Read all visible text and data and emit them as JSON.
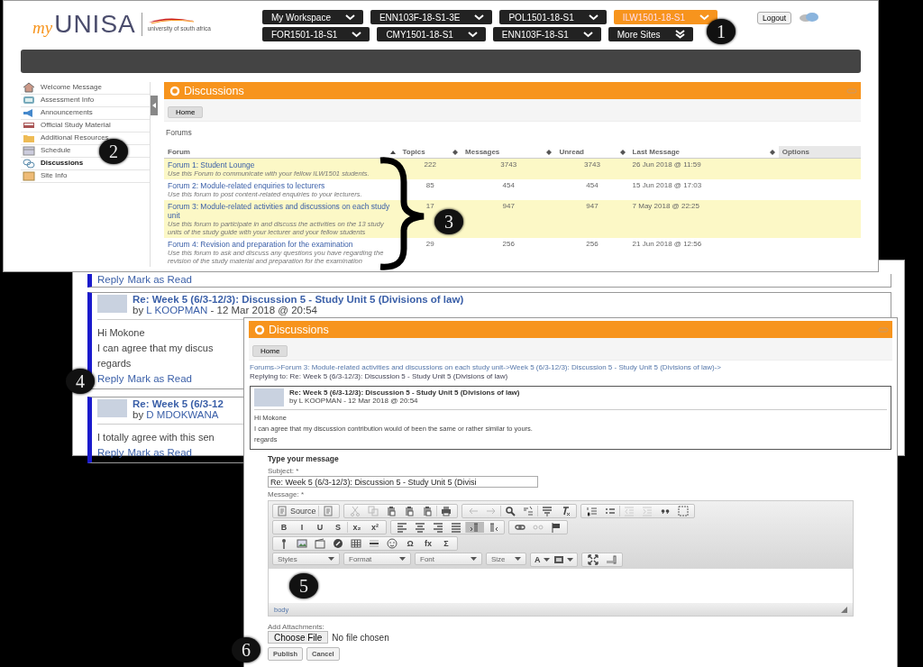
{
  "top_window": {
    "logo": {
      "prefix": "my",
      "name": "UNISA",
      "tagline": "university of south africa"
    },
    "site_tabs": [
      {
        "label": "My Workspace",
        "kind": "menu",
        "selected": false
      },
      {
        "label": "ENN103F-18-S1-3E",
        "kind": "menu",
        "selected": false
      },
      {
        "label": "POL1501-18-S1",
        "kind": "menu",
        "selected": false
      },
      {
        "label": "ILW1501-18-S1",
        "kind": "menu",
        "selected": true
      },
      {
        "label": "FOR1501-18-S1",
        "kind": "menu",
        "selected": false
      },
      {
        "label": "CMY1501-18-S1",
        "kind": "menu",
        "selected": false
      },
      {
        "label": "ENN103F-18-S1",
        "kind": "menu",
        "selected": false
      },
      {
        "label": "More Sites",
        "kind": "more",
        "selected": false
      }
    ],
    "logout": "Logout",
    "sidebar": {
      "items": [
        {
          "label": "Welcome Message",
          "selected": false
        },
        {
          "label": "Assessment Info",
          "selected": false
        },
        {
          "label": "Announcements",
          "selected": false
        },
        {
          "label": "Official Study Material",
          "selected": false
        },
        {
          "label": "Additional Resources",
          "selected": false
        },
        {
          "label": "Schedule",
          "selected": false
        },
        {
          "label": "Discussions",
          "selected": true
        },
        {
          "label": "Site Info",
          "selected": false
        }
      ]
    },
    "tool_title": "Discussions",
    "home": "Home",
    "section": "Forums",
    "table": {
      "columns": [
        {
          "label": "Forum",
          "sorted": true
        },
        {
          "label": "Topics",
          "sorted": false
        },
        {
          "label": "Messages",
          "sorted": false
        },
        {
          "label": "Unread",
          "sorted": false
        },
        {
          "label": "Last Message",
          "sorted": false
        },
        {
          "label": "Options"
        }
      ],
      "rows": [
        {
          "title": "Forum 1: Student Lounge",
          "description": "Use this Forum to communicate with your fellow ILW1501 students.",
          "topics": "222",
          "messages": "3743",
          "unread": "3743",
          "last_message": "26 Jun 2018 @ 11:59"
        },
        {
          "title": "Forum 2: Module-related enquiries to lecturers",
          "description": "Use this forum to post content-related enquiries to your lecturers.",
          "topics": "85",
          "messages": "454",
          "unread": "454",
          "last_message": "15 Jun 2018 @ 17:03"
        },
        {
          "title": "Forum 3: Module-related activities and discussions on each study unit",
          "description": "Use this forum to participate in and discuss the activities on the 13 study units of the study guide with your lecturer and your fellow students",
          "topics": "17",
          "messages": "947",
          "unread": "947",
          "last_message": "7 May 2018 @ 22:25"
        },
        {
          "title": "Forum 4: Revision and preparation for the examination",
          "description": "Use this forum to ask and discuss any questions you have regarding the revision of the study material and preparation for the examination",
          "topics": "29",
          "messages": "256",
          "unread": "256",
          "last_message": "21 Jun 2018 @ 12:56"
        }
      ]
    }
  },
  "thread_window": {
    "posts": [
      {
        "actions": [
          "Reply",
          "Mark as Read"
        ]
      },
      {
        "title": "Re: Week 5 (6/3-12/3): Discussion 5 - Study Unit 5 (Divisions of law)",
        "by": "by",
        "author": "L KOOPMAN",
        "date": "- 12 Mar 2018 @ 20:54",
        "body": [
          "Hi Mokone",
          "I can agree that my discus",
          "regards"
        ],
        "actions": [
          "Reply",
          "Mark as Read"
        ]
      },
      {
        "title": "Re: Week 5 (6/3-12",
        "by": "by",
        "author": "D MDOKWANA",
        "body": [
          "I totally agree with this sen"
        ],
        "actions": [
          "Reply",
          "Mark as Read"
        ]
      }
    ]
  },
  "reply_window": {
    "tool_title": "Discussions",
    "home": "Home",
    "breadcrumb": {
      "links": [
        "Forums",
        "Forum 3: Module-related activities and discussions on each study unit",
        "Week 5 (6/3-12/3): Discussion 5 - Study Unit 5 (Divisions of law)"
      ],
      "separator": "->",
      "current": "Replying to: Re: Week 5 (6/3-12/3): Discussion 5 - Study Unit 5 (Divisions of law)"
    },
    "quoted_post": {
      "title": "Re: Week 5 (6/3-12/3): Discussion 5 - Study Unit 5 (Divisions of law)",
      "byline": "by L KOOPMAN - 12 Mar 2018 @ 20:54",
      "body": [
        "Hi Mokone",
        "I can agree that my discussion contribution would of been the same or rather similar to yours.",
        "regards"
      ]
    },
    "form_heading": "Type your message",
    "subject_label": "Subject: *",
    "subject_value": "Re: Week 5 (6/3-12/3): Discussion 5 - Study Unit 5 (Divisi",
    "message_label": "Message: *",
    "editor": {
      "source": "Source",
      "glyphs": [
        "B",
        "I",
        "U",
        "S",
        "x₂",
        "x²",
        "Ω",
        "fx",
        "Σ",
        "A"
      ],
      "dropdowns": [
        "Styles",
        "Format",
        "Font",
        "Size"
      ],
      "path": "body"
    },
    "attachments_label": "Add Attachments:",
    "file_button": "Choose File",
    "file_status": "No file chosen",
    "buttons": [
      "Publish",
      "Cancel"
    ]
  },
  "annotations": [
    {
      "label": "1"
    },
    {
      "label": "2"
    },
    {
      "label": "3"
    },
    {
      "label": "4"
    },
    {
      "label": "5"
    },
    {
      "label": "6"
    }
  ]
}
